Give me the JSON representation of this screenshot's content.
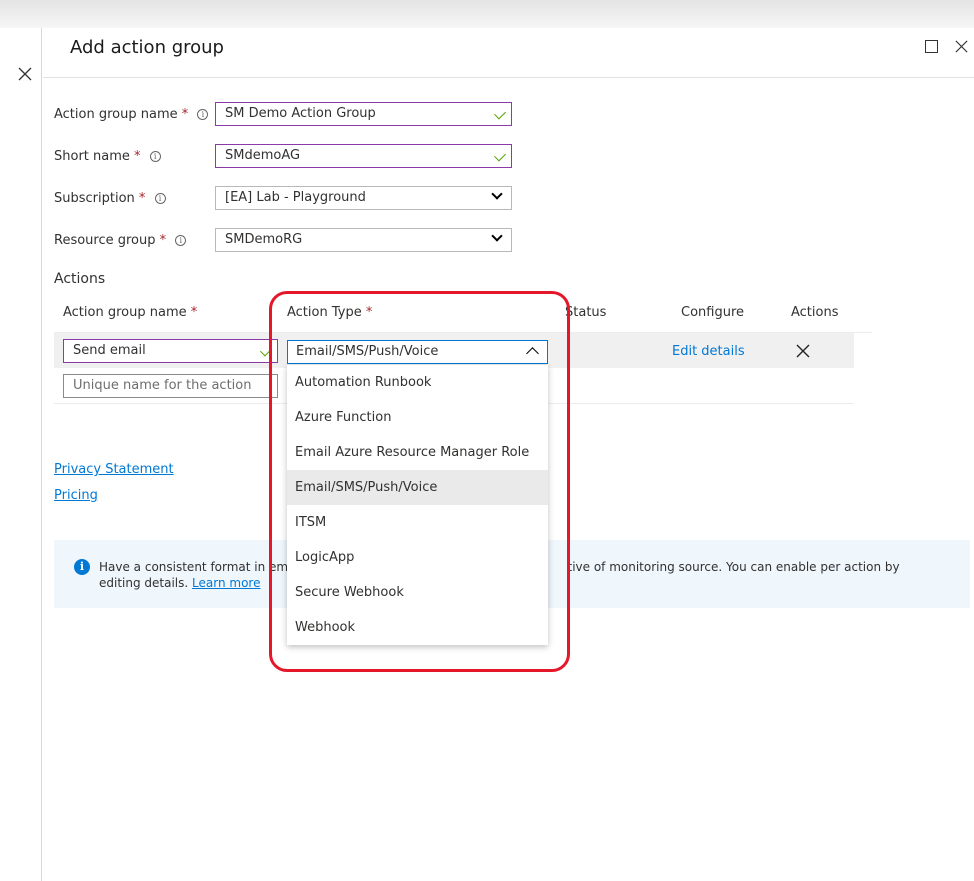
{
  "blade": {
    "title": "Add action group"
  },
  "form": {
    "action_group_name": {
      "label": "Action group name",
      "required": "*",
      "value": "SM Demo Action Group"
    },
    "short_name": {
      "label": "Short name",
      "required": "*",
      "value": "SMdemoAG"
    },
    "subscription": {
      "label": "Subscription",
      "required": "*",
      "value": "[EA] Lab - Playground"
    },
    "resource_group": {
      "label": "Resource group",
      "required": "*",
      "value": "SMDemoRG"
    }
  },
  "actions": {
    "section_title": "Actions",
    "columns": {
      "name": "Action group name",
      "name_required": "*",
      "type": "Action Type",
      "type_required": "*",
      "status": "Status",
      "configure": "Configure",
      "actions": "Actions"
    },
    "row": {
      "name": "Send email",
      "type": "Email/SMS/Push/Voice",
      "configure_link": "Edit details"
    },
    "new_row": {
      "placeholder": "Unique name for the action"
    },
    "dropdown_options": [
      "Automation Runbook",
      "Azure Function",
      "Email Azure Resource Manager Role",
      "Email/SMS/Push/Voice",
      "ITSM",
      "LogicApp",
      "Secure Webhook",
      "Webhook"
    ]
  },
  "links": {
    "privacy": "Privacy Statement",
    "pricing": "Pricing"
  },
  "banner": {
    "text_start": "Have a consistent format in ema",
    "text_end": "tive of monitoring source. You can enable per action by editing details.",
    "link": "Learn more"
  },
  "colors": {
    "accent": "#0078d4",
    "highlight": "#e5182b",
    "valid_border": "#8b3aa8",
    "required": "#a4262c"
  }
}
